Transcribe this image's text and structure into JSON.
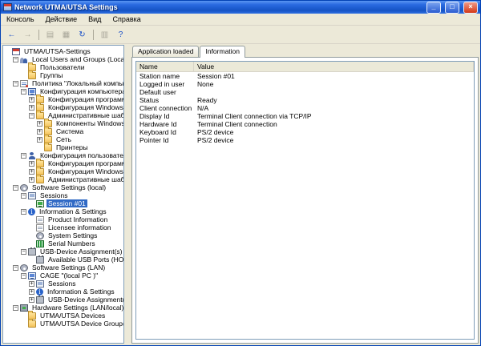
{
  "window": {
    "title": "Network UTMA/UTSA Settings",
    "controls": {
      "minimize": "_",
      "maximize": "□",
      "close": "×"
    }
  },
  "colors": {
    "selection": "#316ac5",
    "titlebar": "#2a6ae0",
    "pane_border": "#7f9db9"
  },
  "menu": {
    "items": [
      "Консоль",
      "Действие",
      "Вид",
      "Справка"
    ]
  },
  "toolbar": {
    "items": [
      {
        "type": "button",
        "name": "back-button-icon",
        "glyph": "←",
        "disabled": false
      },
      {
        "type": "button",
        "name": "forward-button-icon",
        "glyph": "→",
        "disabled": true
      },
      {
        "type": "sep"
      },
      {
        "type": "button",
        "name": "show-console-tree-icon",
        "glyph": "▤",
        "disabled": true
      },
      {
        "type": "button",
        "name": "properties-icon",
        "glyph": "▦",
        "disabled": true
      },
      {
        "type": "button",
        "name": "refresh-icon",
        "glyph": "↻",
        "disabled": false
      },
      {
        "type": "sep"
      },
      {
        "type": "button",
        "name": "export-list-icon",
        "glyph": "▥",
        "disabled": true
      },
      {
        "type": "button",
        "name": "help-icon",
        "glyph": "?",
        "disabled": false
      }
    ]
  },
  "tabs": [
    {
      "label": "Application loaded",
      "active": false
    },
    {
      "label": "Information",
      "active": true
    }
  ],
  "list": {
    "columns": [
      "Name",
      "Value"
    ],
    "rows": [
      {
        "name": "Station name",
        "value": "Session #01"
      },
      {
        "name": "Logged in user",
        "value": "None"
      },
      {
        "name": "Default user",
        "value": ""
      },
      {
        "name": "Status",
        "value": "Ready"
      },
      {
        "name": "Client connection",
        "value": "N/A"
      },
      {
        "name": "Display Id",
        "value": "Terminal Client connection via TCP/IP"
      },
      {
        "name": "Hardware Id",
        "value": "Terminal Client connection"
      },
      {
        "name": "Keyboard Id",
        "value": "PS/2 device"
      },
      {
        "name": "Pointer Id",
        "value": "PS/2 device"
      }
    ]
  },
  "tree": {
    "items": [
      {
        "depth": 0,
        "exp": "none",
        "icon": "console",
        "label": "UTMA/UTSA-Settings"
      },
      {
        "depth": 1,
        "exp": "minus",
        "icon": "users",
        "label": "Local Users and Groups (Local)"
      },
      {
        "depth": 2,
        "exp": "none",
        "icon": "folder",
        "label": "Пользователи"
      },
      {
        "depth": 2,
        "exp": "none",
        "icon": "folder",
        "label": "Группы"
      },
      {
        "depth": 1,
        "exp": "minus",
        "icon": "policy",
        "label": "Политика \"Локальный компьютер\""
      },
      {
        "depth": 2,
        "exp": "minus",
        "icon": "computer",
        "label": "Конфигурация компьютера"
      },
      {
        "depth": 3,
        "exp": "plus",
        "icon": "folder",
        "label": "Конфигурация программ"
      },
      {
        "depth": 3,
        "exp": "plus",
        "icon": "folder",
        "label": "Конфигурация Windows"
      },
      {
        "depth": 3,
        "exp": "minus",
        "icon": "folder",
        "label": "Административные шаблоны"
      },
      {
        "depth": 4,
        "exp": "plus",
        "icon": "folder",
        "label": "Компоненты Windows"
      },
      {
        "depth": 4,
        "exp": "plus",
        "icon": "folder",
        "label": "Система"
      },
      {
        "depth": 4,
        "exp": "plus",
        "icon": "folder",
        "label": "Сеть"
      },
      {
        "depth": 4,
        "exp": "none",
        "icon": "folder",
        "label": "Принтеры"
      },
      {
        "depth": 2,
        "exp": "minus",
        "icon": "user",
        "label": "Конфигурация пользователя"
      },
      {
        "depth": 3,
        "exp": "plus",
        "icon": "folder",
        "label": "Конфигурация программ"
      },
      {
        "depth": 3,
        "exp": "plus",
        "icon": "folder",
        "label": "Конфигурация Windows"
      },
      {
        "depth": 3,
        "exp": "plus",
        "icon": "folder",
        "label": "Административные шаблоны"
      },
      {
        "depth": 1,
        "exp": "minus",
        "icon": "gear",
        "label": "Software Settings (local)"
      },
      {
        "depth": 2,
        "exp": "minus",
        "icon": "sessions",
        "label": "Sessions"
      },
      {
        "depth": 3,
        "exp": "none",
        "icon": "monitor-green",
        "label": "Session #01",
        "selected": true
      },
      {
        "depth": 2,
        "exp": "minus",
        "icon": "info",
        "label": "Information & Settings"
      },
      {
        "depth": 3,
        "exp": "none",
        "icon": "doc",
        "label": "Product Information"
      },
      {
        "depth": 3,
        "exp": "none",
        "icon": "doc",
        "label": "Licensee information"
      },
      {
        "depth": 3,
        "exp": "none",
        "icon": "gear",
        "label": "System Settings"
      },
      {
        "depth": 3,
        "exp": "none",
        "icon": "serial",
        "label": "Serial Numbers"
      },
      {
        "depth": 2,
        "exp": "minus",
        "icon": "usb",
        "label": "USB-Device Assignment(s)"
      },
      {
        "depth": 3,
        "exp": "none",
        "icon": "usb",
        "label": "Available USB Ports (HOST-PC), Sett"
      },
      {
        "depth": 1,
        "exp": "minus",
        "icon": "gear",
        "label": "Software Settings (LAN)"
      },
      {
        "depth": 2,
        "exp": "minus",
        "icon": "computer",
        "label": "CAGE \"(local PC )\""
      },
      {
        "depth": 3,
        "exp": "plus",
        "icon": "sessions",
        "label": "Sessions"
      },
      {
        "depth": 3,
        "exp": "plus",
        "icon": "info",
        "label": "Information & Settings"
      },
      {
        "depth": 3,
        "exp": "plus",
        "icon": "usb",
        "label": "USB-Device Assignment(s)"
      },
      {
        "depth": 1,
        "exp": "minus",
        "icon": "hardware",
        "label": "Hardware Settings (LAN/local)"
      },
      {
        "depth": 2,
        "exp": "none",
        "icon": "folder",
        "label": "UTMA/UTSA Devices"
      },
      {
        "depth": 2,
        "exp": "none",
        "icon": "folder",
        "label": "UTMA/UTSA Device Group(s)"
      }
    ]
  }
}
